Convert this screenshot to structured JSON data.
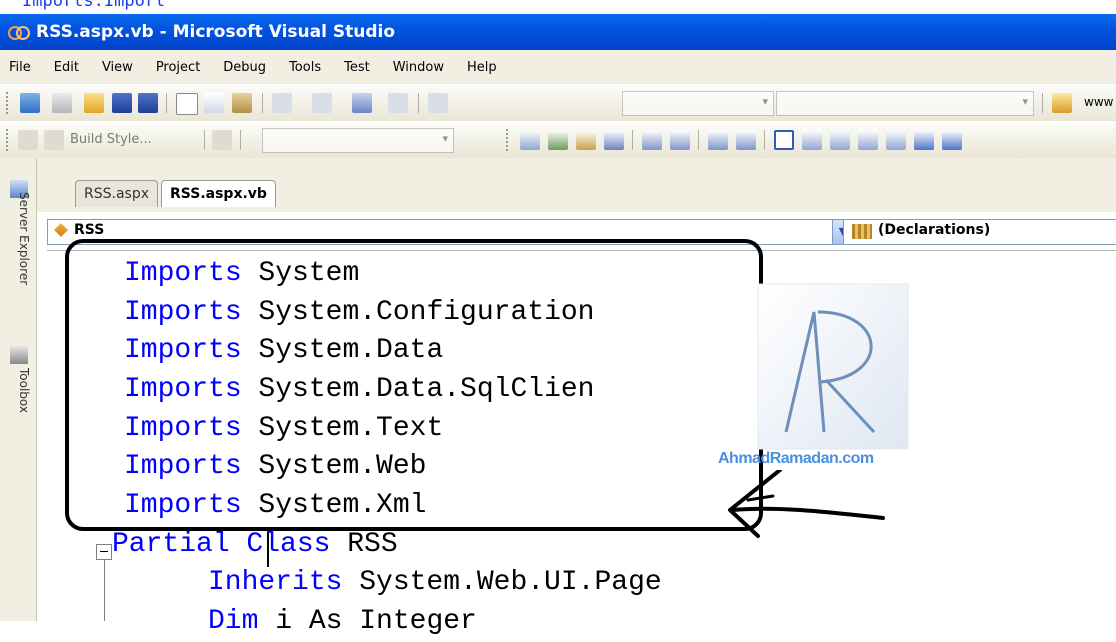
{
  "window": {
    "title": "RSS.aspx.vb - Microsoft Visual Studio",
    "top_strip_text": "Imports.Import"
  },
  "menu": [
    "File",
    "Edit",
    "View",
    "Project",
    "Debug",
    "Tools",
    "Test",
    "Window",
    "Help"
  ],
  "toolbar": {
    "url_fragment": "www",
    "build_style_label": "Build Style..."
  },
  "sidebar": {
    "server_explorer_label": "Server Explorer",
    "toolbox_label": "Toolbox"
  },
  "tabs": [
    {
      "label": "RSS.aspx",
      "active": false
    },
    {
      "label": "RSS.aspx.vb",
      "active": true
    }
  ],
  "navigation": {
    "class_dropdown": "RSS",
    "method_dropdown": "(Declarations)"
  },
  "code_lines": [
    {
      "keyword": "Imports",
      "text": " System"
    },
    {
      "keyword": "Imports",
      "text": " System.Configuration"
    },
    {
      "keyword": "Imports",
      "text": " System.Data"
    },
    {
      "keyword": "Imports",
      "text": " System.Data.SqlClien"
    },
    {
      "keyword": "Imports",
      "text": " System.Text"
    },
    {
      "keyword": "Imports",
      "text": " System.Web"
    },
    {
      "keyword": "Imports",
      "text": " System.Xml"
    },
    {
      "keyword": "Partial Class",
      "text": " RSS"
    },
    {
      "keyword": "Inherits",
      "text": " System.Web.UI.Page"
    },
    {
      "keyword": "Dim",
      "text": " i As Integer"
    }
  ],
  "watermark": {
    "text": "AhmadRamadan.com"
  },
  "colors": {
    "keyword": "#0000ff",
    "title_bar": "#0454e0",
    "chrome": "#f1efe2",
    "watermark": "#4b8fe0"
  }
}
